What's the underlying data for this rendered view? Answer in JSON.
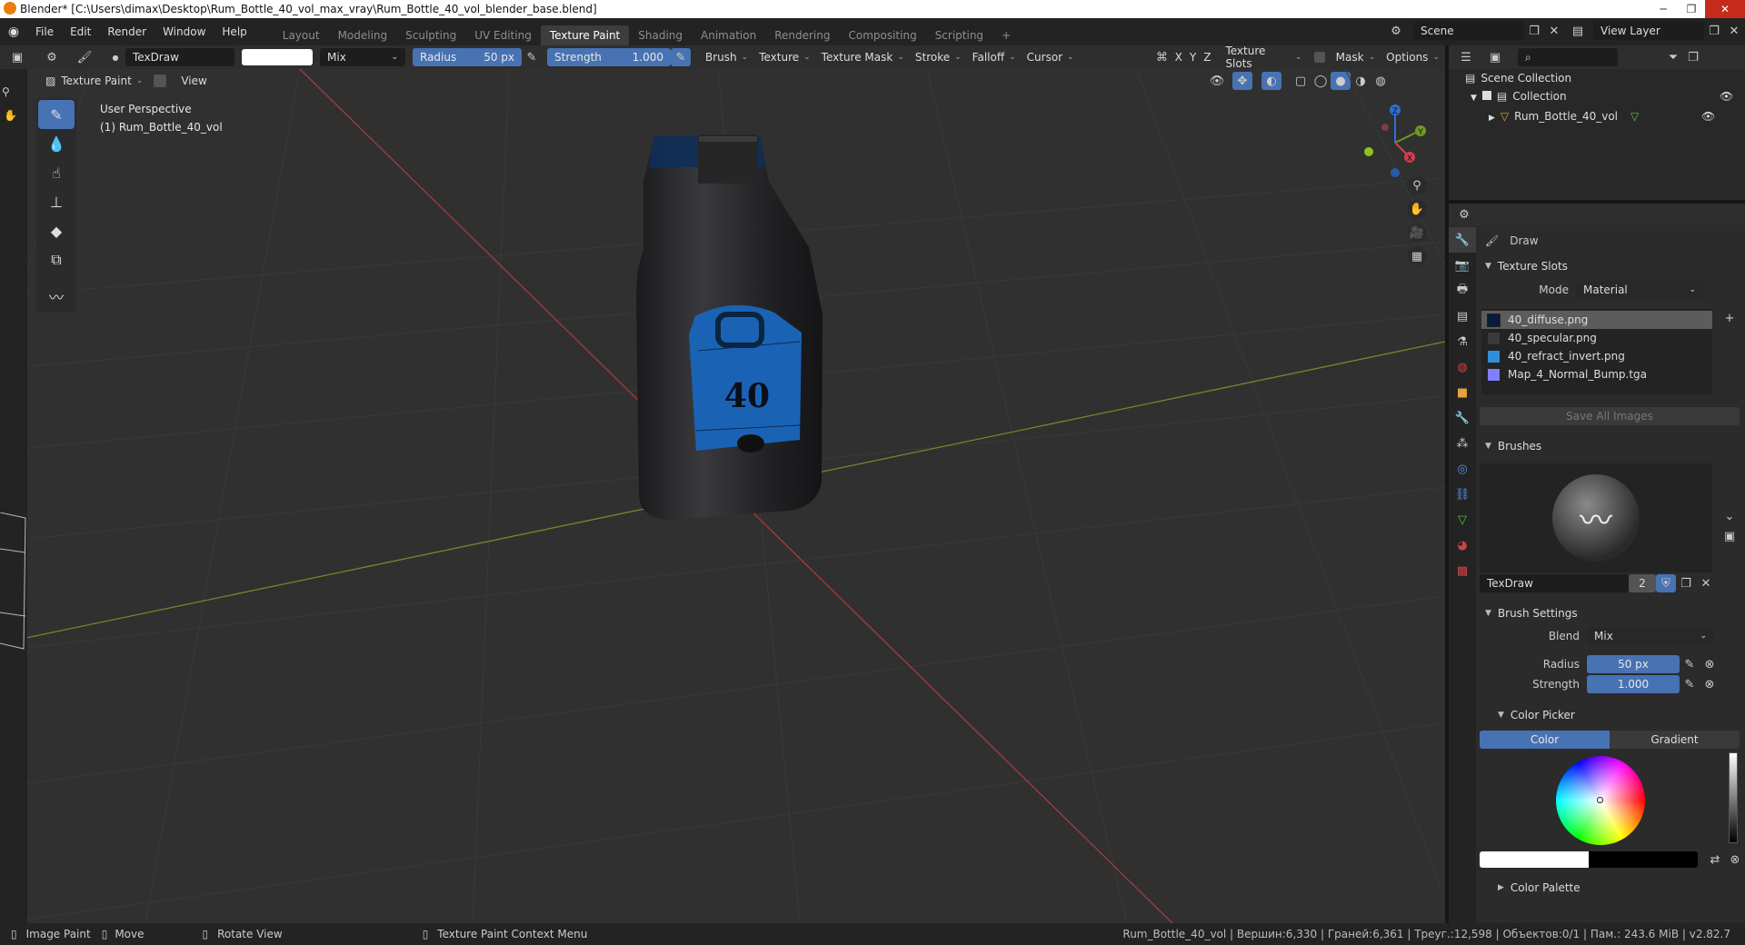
{
  "window": {
    "title": "Blender* [C:\\Users\\dimax\\Desktop\\Rum_Bottle_40_vol_max_vray\\Rum_Bottle_40_vol_blender_base.blend]"
  },
  "menu": [
    "File",
    "Edit",
    "Render",
    "Window",
    "Help"
  ],
  "workspaces": [
    "Layout",
    "Modeling",
    "Sculpting",
    "UV Editing",
    "Texture Paint",
    "Shading",
    "Animation",
    "Rendering",
    "Compositing",
    "Scripting"
  ],
  "active_workspace": "Texture Paint",
  "scene": {
    "name": "Scene",
    "view_layer": "View Layer"
  },
  "toolsettings": {
    "brush_name": "TexDraw",
    "blend": "Mix",
    "radius_label": "Radius",
    "radius_value": "50 px",
    "strength_label": "Strength",
    "strength_value": "1.000",
    "menus": [
      "Brush",
      "Texture",
      "Texture Mask",
      "Stroke",
      "Falloff",
      "Cursor"
    ],
    "axes": [
      "X",
      "Y",
      "Z"
    ],
    "right_menus": [
      "Texture Slots",
      "Mask",
      "Options"
    ]
  },
  "viewport_header": {
    "mode": "Texture Paint",
    "view": "View"
  },
  "viewport": {
    "perspective": "User Perspective",
    "object_label": "(1) Rum_Bottle_40_vol",
    "bottle_label": "40",
    "gizmo": {
      "x": "X",
      "y": "Y",
      "z": "Z"
    }
  },
  "outliner": {
    "scene_collection": "Scene Collection",
    "collection": "Collection",
    "object": "Rum_Bottle_40_vol"
  },
  "properties": {
    "tool_name": "Draw",
    "texture_slots": {
      "title": "Texture Slots",
      "mode_label": "Mode",
      "mode_value": "Material",
      "slots": [
        {
          "name": "40_diffuse.png",
          "color": "#0a1a3a"
        },
        {
          "name": "40_specular.png",
          "color": "#3a3a3a"
        },
        {
          "name": "40_refract_invert.png",
          "color": "#2f8fd8"
        },
        {
          "name": "Map_4_Normal_Bump.tga",
          "color": "#8080ff"
        }
      ],
      "save_all": "Save All Images"
    },
    "brushes": {
      "title": "Brushes",
      "name": "TexDraw",
      "users": "2"
    },
    "brush_settings": {
      "title": "Brush Settings",
      "blend_label": "Blend",
      "blend_value": "Mix",
      "radius_label": "Radius",
      "radius_value": "50 px",
      "strength_label": "Strength",
      "strength_value": "1.000"
    },
    "color_picker": {
      "title": "Color Picker",
      "tab_color": "Color",
      "tab_gradient": "Gradient"
    },
    "color_palette": {
      "title": "Color Palette"
    }
  },
  "statusbar": {
    "items": [
      "Image Paint",
      "Move",
      "Rotate View",
      "Texture Paint Context Menu"
    ],
    "info": "Rum_Bottle_40_vol | Вершин:6,330 | Граней:6,361 | Треуг.:12,598 | Объектов:0/1 | Пам.: 243.6 MiB | v2.82.7"
  },
  "colors": {
    "accent": "#4772b3",
    "label_blue": "#1a6fd0",
    "bg": "#303030"
  }
}
